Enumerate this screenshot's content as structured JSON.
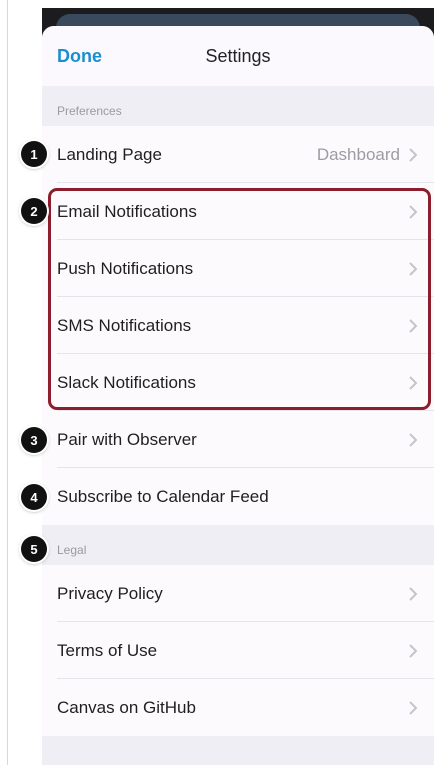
{
  "navbar": {
    "done_label": "Done",
    "title": "Settings"
  },
  "sections": [
    {
      "header": "Preferences"
    },
    {
      "header": "Legal"
    }
  ],
  "rows": {
    "landing_page": {
      "label": "Landing Page",
      "value": "Dashboard"
    },
    "email_notifications": {
      "label": "Email Notifications"
    },
    "push_notifications": {
      "label": "Push Notifications"
    },
    "sms_notifications": {
      "label": "SMS Notifications"
    },
    "slack_notifications": {
      "label": "Slack Notifications"
    },
    "pair_with_observer": {
      "label": "Pair with Observer"
    },
    "subscribe_calendar": {
      "label": "Subscribe to Calendar Feed"
    },
    "privacy_policy": {
      "label": "Privacy Policy"
    },
    "terms_of_use": {
      "label": "Terms of Use"
    },
    "canvas_github": {
      "label": "Canvas on GitHub"
    }
  },
  "markers": [
    "1",
    "2",
    "3",
    "4",
    "5"
  ],
  "colors": {
    "accent": "#1a8fd0",
    "highlight": "#8b1d2c",
    "marker": "#111111"
  }
}
